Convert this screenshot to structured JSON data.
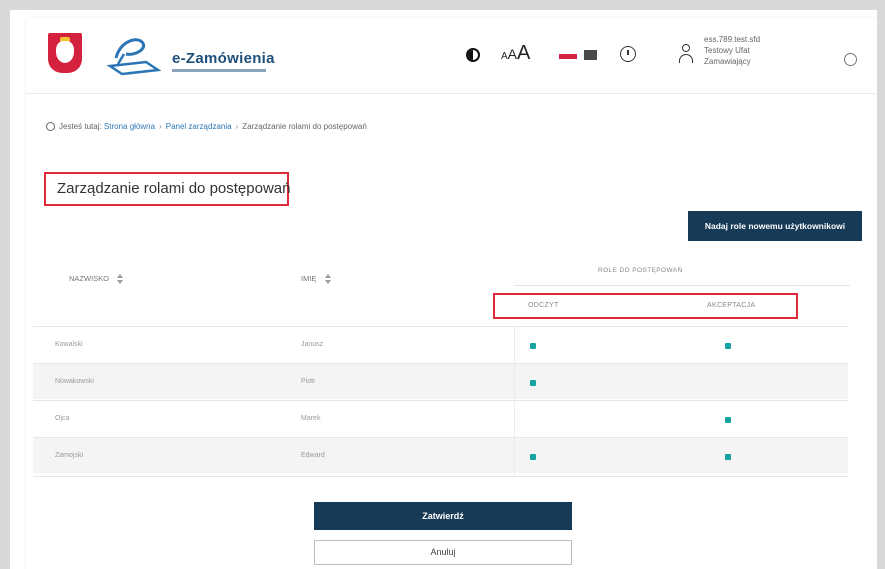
{
  "header": {
    "logo_text": "e-Zamówienia",
    "font_sizes": [
      "A",
      "A",
      "A"
    ],
    "user_info": [
      "ess.789.test.sfd",
      "Testowy Ufat",
      "Zamawiający"
    ],
    "icons": {
      "emblem": "poland-emblem-icon",
      "logo": "e-zamowienia-logo-icon",
      "contrast": "contrast-icon",
      "language_pl": "flag-pl-icon",
      "language_en": "flag-en-icon",
      "clock": "clock-icon",
      "user": "user-icon",
      "logout": "power-icon"
    }
  },
  "breadcrumb": {
    "items": [
      "Jesteś tutaj:",
      "Strona główna",
      "Panel zarządzania",
      "Zarządzanie rolami do postępowań"
    ]
  },
  "page": {
    "title": "Zarządzanie rolami do postępowań"
  },
  "actions": {
    "assign_label": "Nadaj role nowemu użytkownikowi",
    "save_label": "Zatwierdź",
    "cancel_label": "Anuluj"
  },
  "table": {
    "col_surname": "NAZWISKO",
    "col_name": "IMIĘ",
    "group_header": "ROLE DO POSTĘPOWAŃ",
    "role_columns": [
      "ODCZYT",
      "AKCEPTACJA"
    ],
    "rows": [
      {
        "surname": "Kowalski",
        "name": "Janusz",
        "read": true,
        "accept": true,
        "shaded": false
      },
      {
        "surname": "Nowakowski",
        "name": "Piotr",
        "read": true,
        "accept": false,
        "shaded": true
      },
      {
        "surname": "Ojca",
        "name": "Marek",
        "read": false,
        "accept": true,
        "shaded": false
      },
      {
        "surname": "Zamojski",
        "name": "Edward",
        "read": true,
        "accept": true,
        "shaded": true
      }
    ]
  },
  "colors": {
    "primary": "#173a57",
    "highlight": "#e0283a",
    "check": "#16a3a0"
  }
}
